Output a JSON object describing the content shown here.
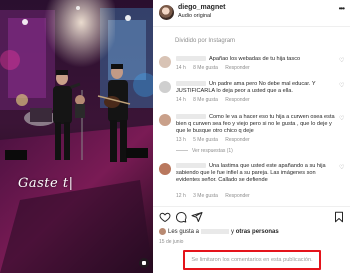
{
  "media": {
    "caption_text": "Gaste t|",
    "mute_icon": "speaker-muted-icon"
  },
  "header": {
    "username": "diego_magnet",
    "subtitle": "Audio original",
    "more_icon": "more-horizontal-icon"
  },
  "feed": {
    "edited_label": "Dividido por Instagram",
    "comments": [
      {
        "text": "Apañao los webadas de tu hija tasco",
        "meta": [
          "14 h",
          "8 Me gusta",
          "Responder"
        ],
        "avatar_color": "#d8c3b5"
      },
      {
        "text": "Un padre ama pero No debe mal educar. Y JUSTIFICARLA lo deja peor a usted que a ella.",
        "meta": [
          "14 h",
          "8 Me gusta",
          "Responder"
        ],
        "avatar_color": "#cfcfcf"
      },
      {
        "text": "Como le va a hacer eso tu hija a curwen osea esta bien q curwen sea feo y viejo pero si no le gusta , que lo deje y que le busque otro chico q deje",
        "meta": [
          "13 h",
          "5 Me gusta",
          "Responder"
        ],
        "avatar_color": "#c9a08a",
        "replies": "Ver respuestas (1)"
      },
      {
        "text": "Una lastima que usted este apañando a su hija sabiendo que le fue infiel a su pareja. Las imágenes son evidentes señor. Callado se defiende",
        "meta": [
          "12 h",
          "3 Me gusta",
          "Responder"
        ],
        "avatar_color": "#b9785e"
      }
    ]
  },
  "actions": {
    "like_icon": "heart-icon",
    "comment_icon": "comment-icon",
    "share_icon": "share-icon",
    "save_icon": "bookmark-icon"
  },
  "likes": {
    "prefix": "Les gusta a",
    "connector": "y",
    "others": "otras personas"
  },
  "date": "15 de junio",
  "comments_disabled": "Se limitaron los comentarios en esta publicación."
}
